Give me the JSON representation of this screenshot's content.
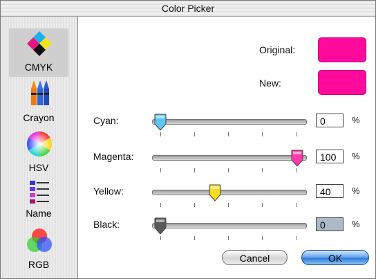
{
  "window": {
    "title": "Color Picker"
  },
  "sidebar": {
    "items": [
      {
        "label": "CMYK",
        "icon": "cmyk-diamond-icon",
        "selected": true
      },
      {
        "label": "Crayon",
        "icon": "crayons-icon"
      },
      {
        "label": "HSV",
        "icon": "color-wheel-icon"
      },
      {
        "label": "Name",
        "icon": "name-list-icon"
      },
      {
        "label": "RGB",
        "icon": "rgb-circles-icon"
      }
    ]
  },
  "preview": {
    "original_label": "Original:",
    "new_label": "New:",
    "original_color": "#ff0a9c",
    "new_color": "#ff0a9c"
  },
  "sliders": [
    {
      "label": "Cyan:",
      "value": "0",
      "level": 0,
      "unit": "%",
      "thumb_color": "#5ec6f4"
    },
    {
      "label": "Magenta:",
      "value": "100",
      "level": 100,
      "unit": "%",
      "thumb_color": "#ff3aa8"
    },
    {
      "label": "Yellow:",
      "value": "40",
      "level": 40,
      "unit": "%",
      "thumb_color": "#f6dc1a"
    },
    {
      "label": "Black:",
      "value": "0",
      "level": 0,
      "unit": "%",
      "thumb_color": "#5a5a5a"
    }
  ],
  "buttons": {
    "cancel_label": "Cancel",
    "ok_label": "OK"
  }
}
